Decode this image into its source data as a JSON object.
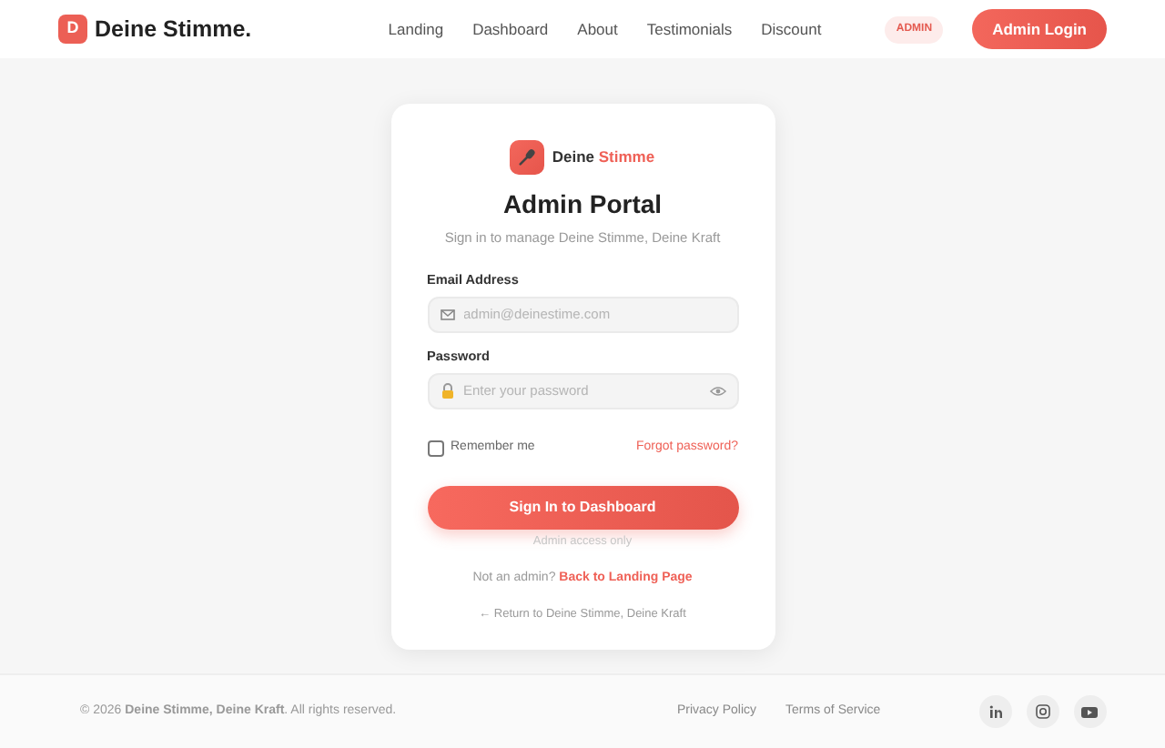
{
  "navbar": {
    "logo_letter": "D",
    "brand": "Deine Stimme.",
    "links": [
      "Landing",
      "Dashboard",
      "About",
      "Testimonials",
      "Discount"
    ],
    "badge": "ADMIN",
    "login_button": "Admin Login"
  },
  "card": {
    "brand": {
      "text": "Deine",
      "accent": "Stimme"
    },
    "title": "Admin Portal",
    "subtitle": "Sign in to manage Deine Stimme, Deine Kraft",
    "fields": [
      {
        "label": "Email Address",
        "kind": "email",
        "placeholder": "admin@deinestime.com"
      },
      {
        "label": "Password",
        "kind": "password",
        "placeholder": "Enter your password"
      }
    ],
    "remember": {
      "label": "Remember me",
      "checked": false
    },
    "forgot": "Forgot password?",
    "submit": "Sign In to Dashboard",
    "note": "Admin access only",
    "not_admin": "Not an admin?",
    "back_link": "Back to Landing Page",
    "return_link": "← Return to Deine Stimme, Deine Kraft"
  },
  "footer": {
    "copyright": "© 2026 **Deine Stimme, Deine Kraft**. All rights reserved.",
    "links": [
      "Privacy Policy",
      "Terms of Service"
    ],
    "social": [
      {
        "kind": "linkedin"
      },
      {
        "kind": "instagram"
      },
      {
        "kind": "youtube"
      }
    ]
  }
}
